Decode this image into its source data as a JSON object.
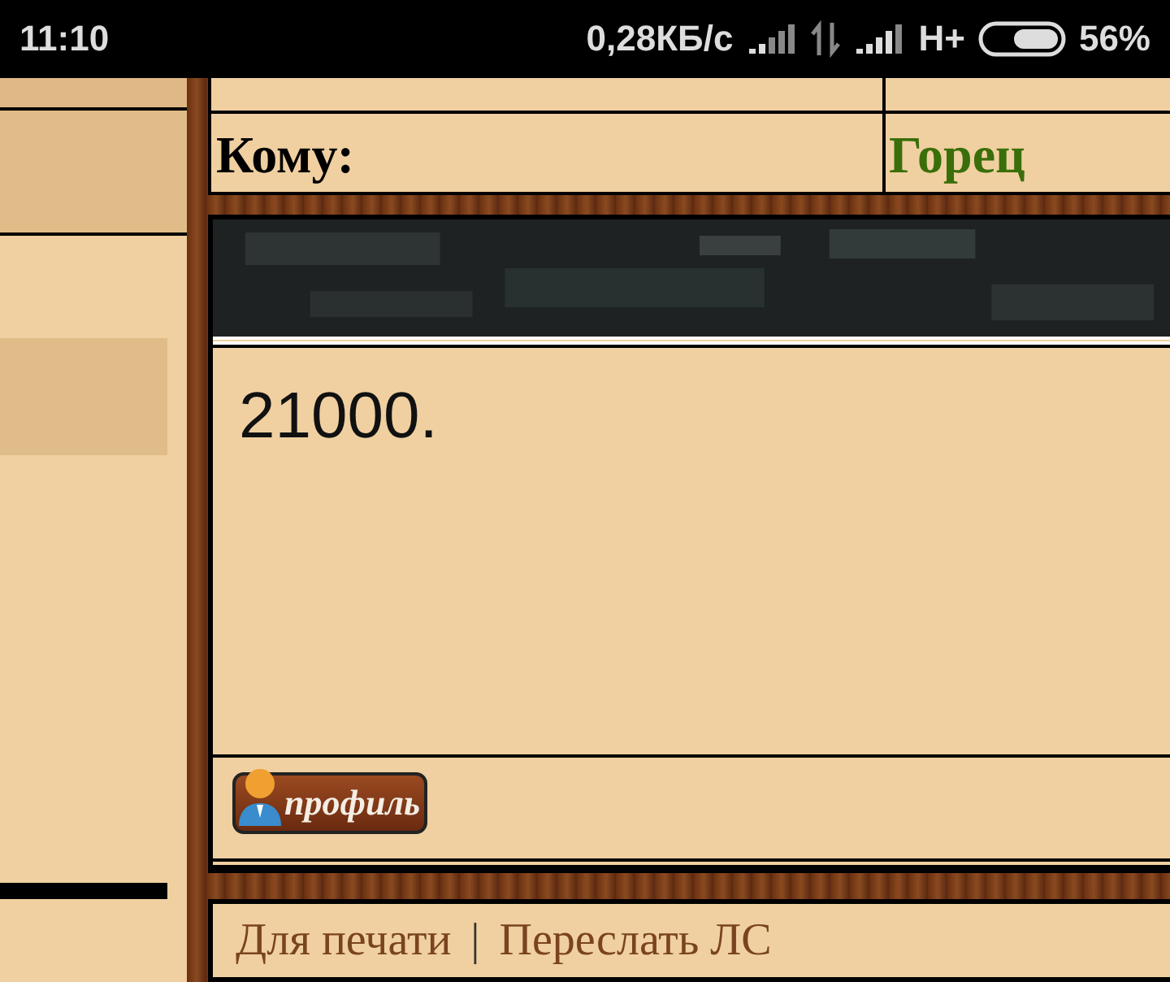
{
  "status_bar": {
    "time": "11:10",
    "speed": "0,28КБ/с",
    "network": "H+",
    "battery": "56%"
  },
  "header": {
    "label": "Кому:",
    "value": "Горец"
  },
  "message": {
    "body": "21000.",
    "profile_button": "профиль"
  },
  "links": [
    {
      "label": "Для печати"
    },
    {
      "label": "Переслать ЛС"
    }
  ],
  "separator": "|"
}
